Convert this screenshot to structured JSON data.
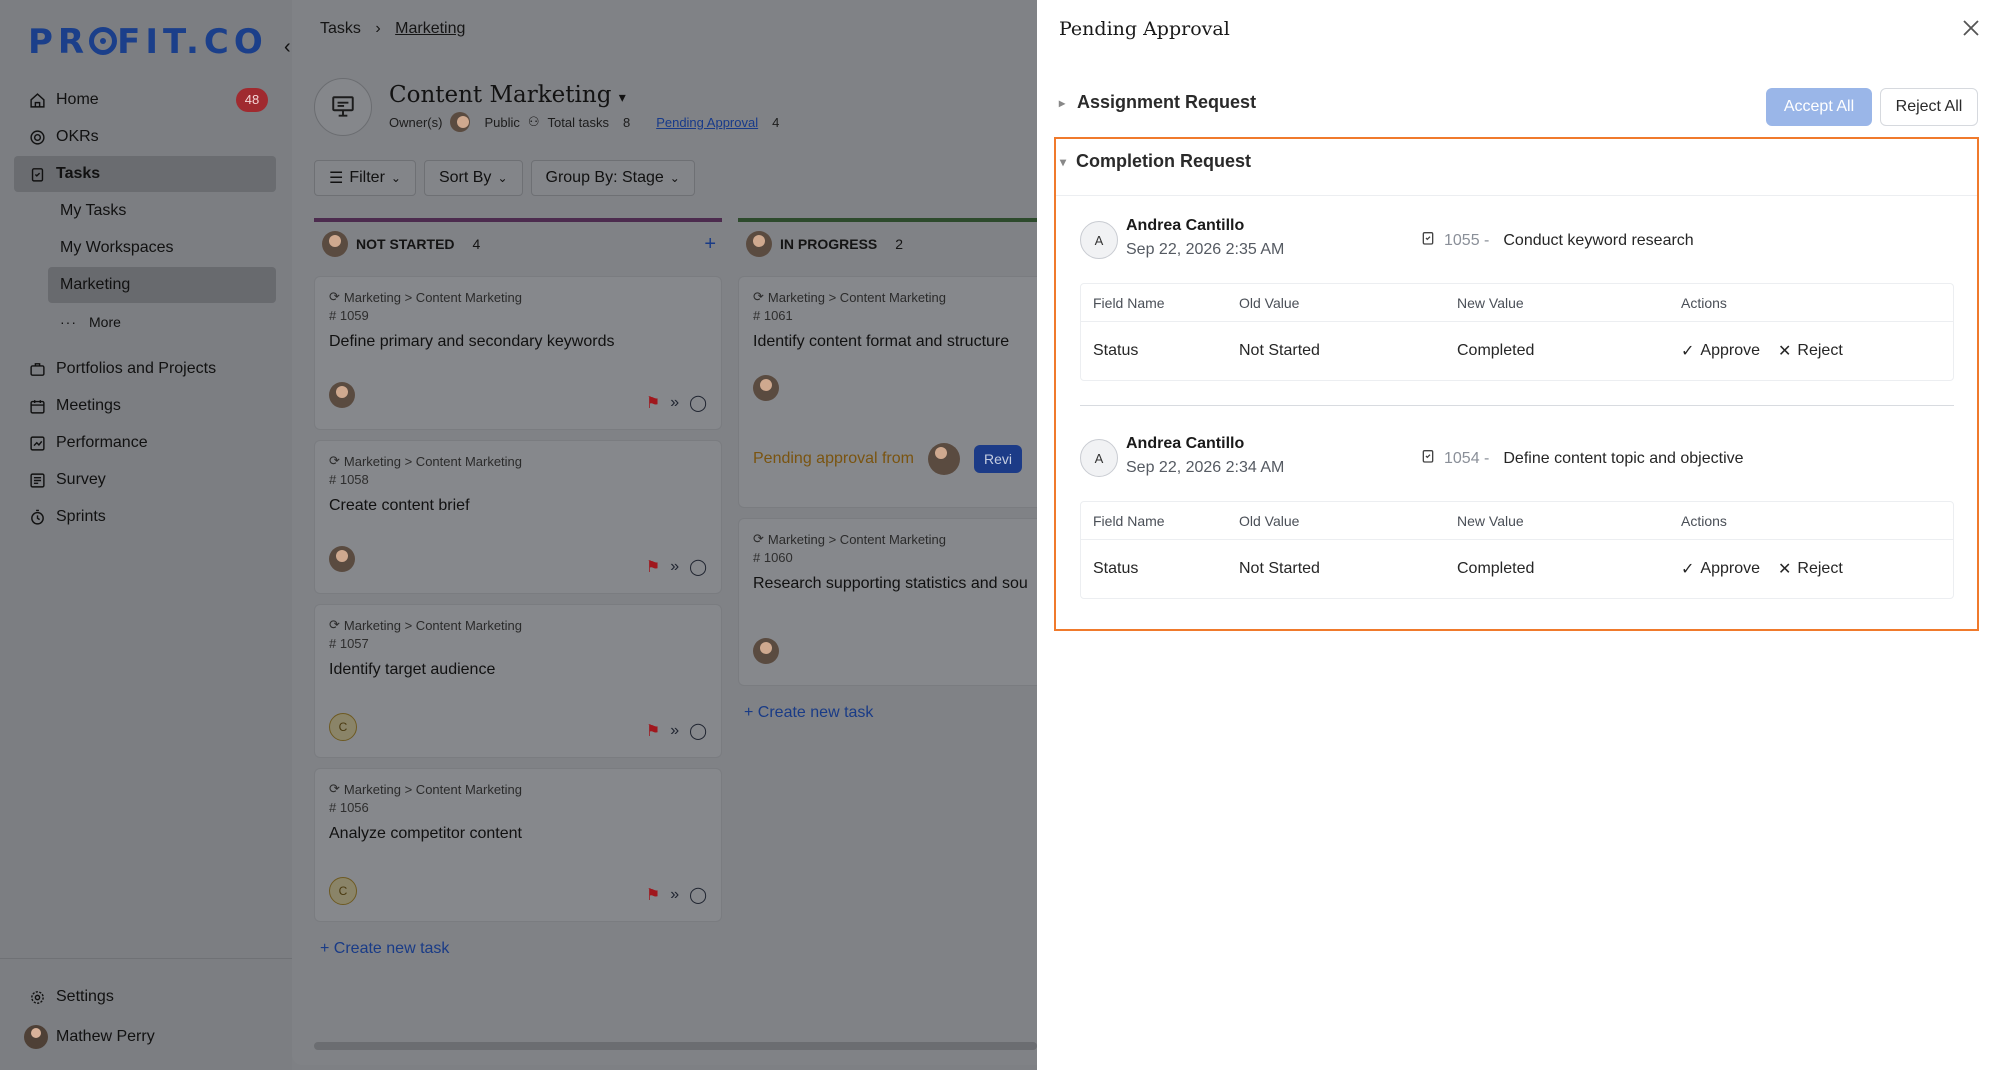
{
  "sidebar": {
    "logo": "PROFIT.CO",
    "items": [
      {
        "label": "Home",
        "badge": "48"
      },
      {
        "label": "OKRs"
      },
      {
        "label": "Tasks"
      },
      {
        "label": "My Tasks"
      },
      {
        "label": "My Workspaces"
      },
      {
        "label": "Marketing"
      },
      {
        "label": "More"
      },
      {
        "label": "Portfolios and Projects"
      },
      {
        "label": "Meetings"
      },
      {
        "label": "Performance"
      },
      {
        "label": "Survey"
      },
      {
        "label": "Sprints"
      }
    ],
    "settings": "Settings",
    "user": "Mathew Perry"
  },
  "main": {
    "breadcrumb": [
      "Tasks",
      "Marketing"
    ],
    "title": "Content Marketing",
    "owner_label": "Owner(s)",
    "visibility": "Public",
    "total_tasks_label": "Total tasks",
    "total_tasks": "8",
    "pending_label": "Pending Approval",
    "pending_count": "4",
    "toolbar": {
      "filter": "Filter",
      "sort": "Sort By",
      "group": "Group By: Stage"
    },
    "columns": [
      {
        "name": "NOT STARTED",
        "count": "4",
        "cards": [
          {
            "path": "Marketing > Content Marketing",
            "num": "# 1059",
            "title": "Define primary and secondary keywords",
            "assignee": ""
          },
          {
            "path": "Marketing > Content Marketing",
            "num": "# 1058",
            "title": "Create content brief",
            "assignee": ""
          },
          {
            "path": "Marketing > Content Marketing",
            "num": "# 1057",
            "title": "Identify target audience",
            "assignee": "C"
          },
          {
            "path": "Marketing > Content Marketing",
            "num": "# 1056",
            "title": "Analyze competitor content",
            "assignee": "C"
          }
        ],
        "create": "Create new task"
      },
      {
        "name": "IN PROGRESS",
        "count": "2",
        "cards": [
          {
            "path": "Marketing > Content Marketing",
            "num": "# 1061",
            "title": "Identify content format and structure",
            "pending": "Pending approval from",
            "review": "Revi"
          },
          {
            "path": "Marketing > Content Marketing",
            "num": "# 1060",
            "title": "Research supporting statistics and sou"
          }
        ],
        "create": "Create new task"
      }
    ]
  },
  "drawer": {
    "title": "Pending Approval",
    "assignment_label": "Assignment Request",
    "accept_all": "Accept All",
    "reject_all": "Reject All",
    "completion_label": "Completion Request",
    "table_headers": [
      "Field Name",
      "Old Value",
      "New Value",
      "Actions"
    ],
    "approve": "Approve",
    "reject": "Reject",
    "requests": [
      {
        "initial": "A",
        "name": "Andrea Cantillo",
        "date": "Sep 22, 2026 2:35 AM",
        "task_id": "1055 -",
        "task_name": "Conduct keyword research",
        "field": "Status",
        "old": "Not Started",
        "new": "Completed"
      },
      {
        "initial": "A",
        "name": "Andrea Cantillo",
        "date": "Sep 22, 2026 2:34 AM",
        "task_id": "1054 -",
        "task_name": "Define content topic and objective",
        "field": "Status",
        "old": "Not Started",
        "new": "Completed"
      }
    ]
  },
  "colors": {
    "accent": "#f07a2c",
    "brand": "#1b3f8a",
    "accept": "#9ab6e8"
  }
}
